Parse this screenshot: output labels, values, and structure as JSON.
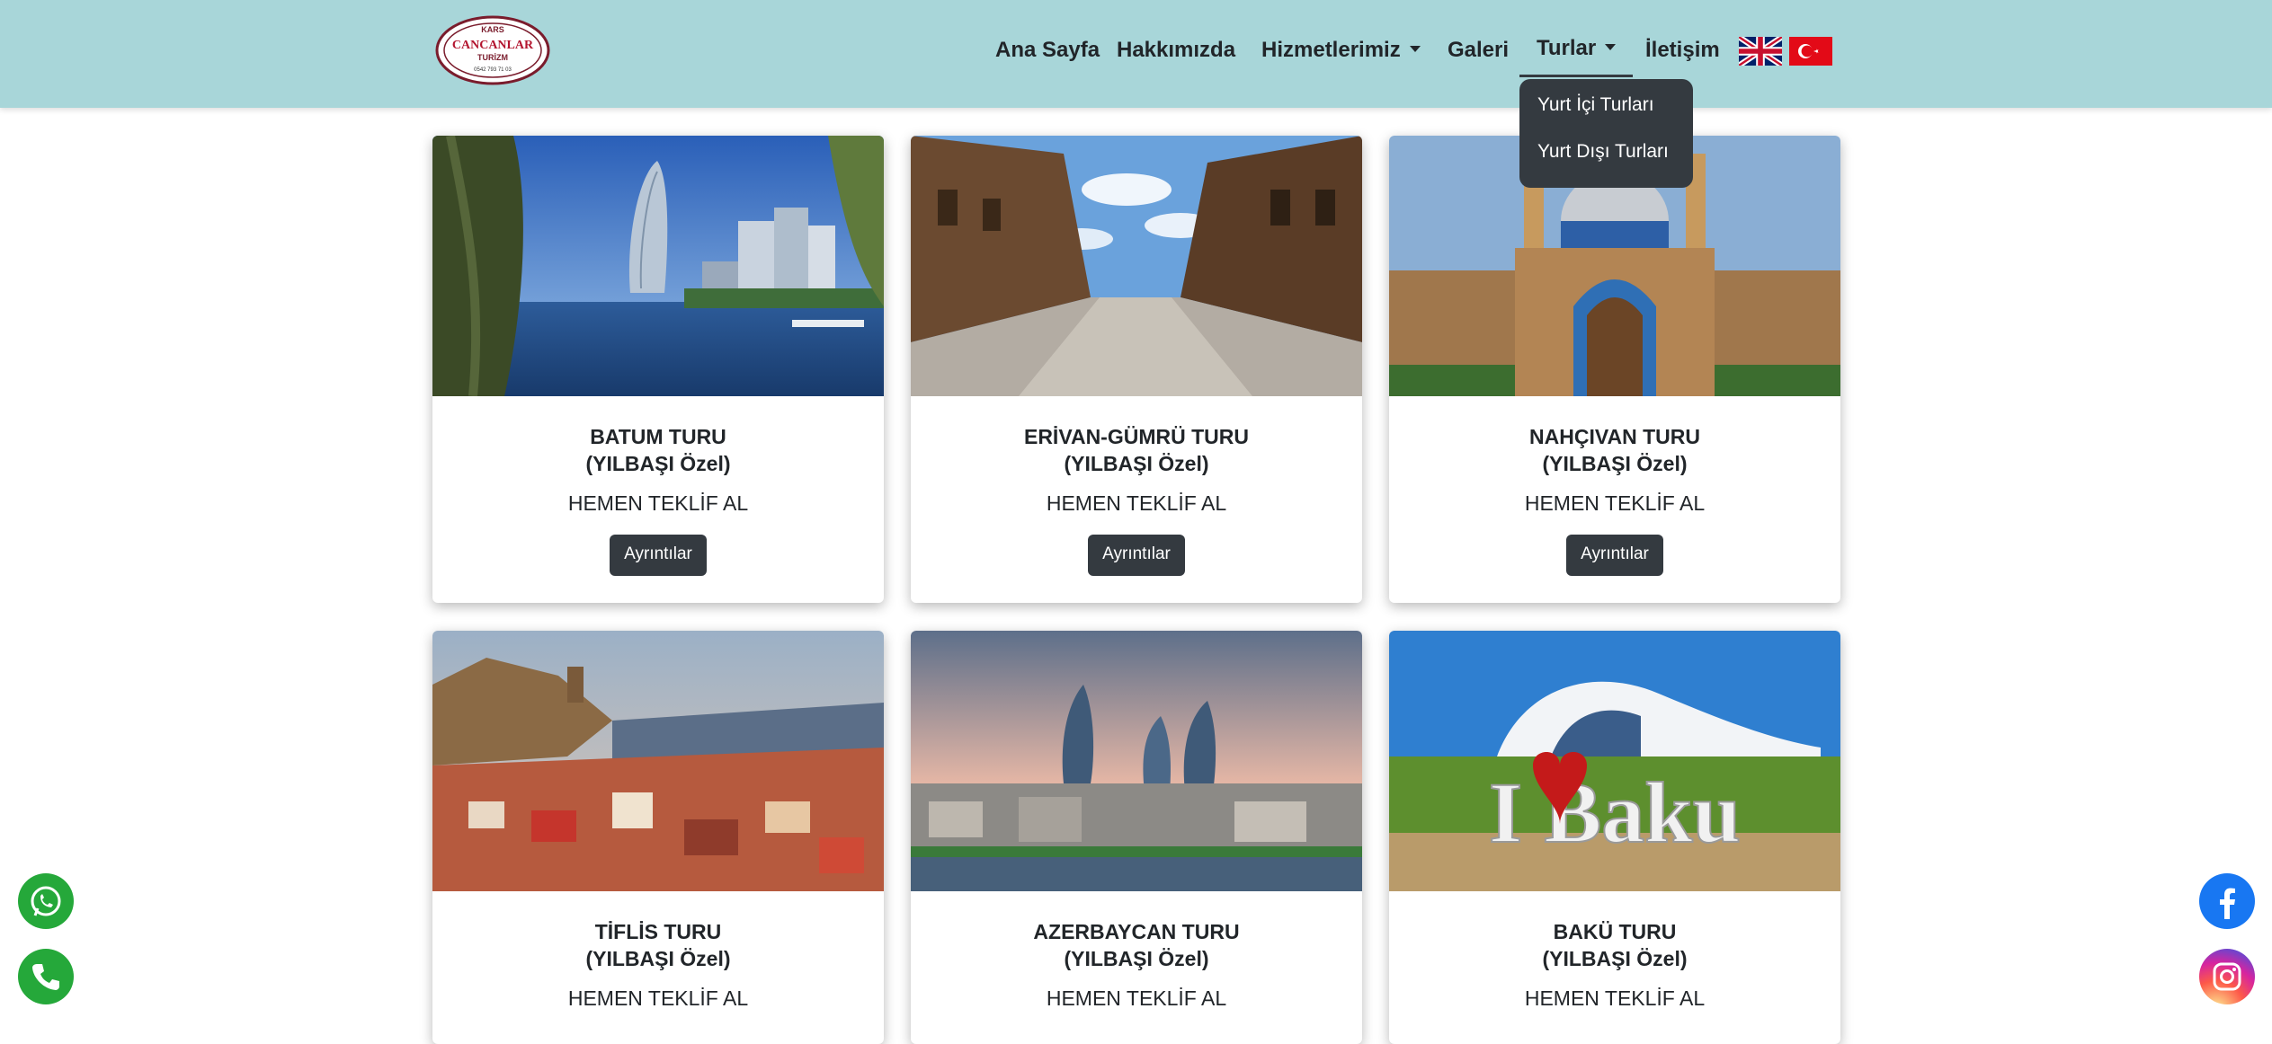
{
  "brand": {
    "logo_text_top": "KARS",
    "logo_text_main": "CANCANLAR",
    "logo_text_sub": "TURİZM",
    "logo_phone": "0542 793 71 03"
  },
  "nav": {
    "home": "Ana Sayfa",
    "about": "Hakkımızda",
    "services": "Hizmetlerimiz",
    "gallery": "Galeri",
    "tours": "Turlar",
    "contact": "İletişim"
  },
  "tours_dropdown": {
    "domestic": "Yurt İçi Turları",
    "international": "Yurt Dışı Turları"
  },
  "cards": [
    {
      "title_line1": "BATUM TURU",
      "title_line2": "(YILBAŞI Özel)",
      "offer": "HEMEN TEKLİF AL",
      "button": "Ayrıntılar",
      "image": "batumi-skyline-lake"
    },
    {
      "title_line1": "ERİVAN-GÜMRÜ TURU",
      "title_line2": "(YILBAŞI Özel)",
      "offer": "HEMEN TEKLİF AL",
      "button": "Ayrıntılar",
      "image": "gyumri-stone-street"
    },
    {
      "title_line1": "NAHÇIVAN TURU",
      "title_line2": "(YILBAŞI Özel)",
      "offer": "HEMEN TEKLİF AL",
      "button": "Ayrıntılar",
      "image": "nakhchivan-mosque"
    },
    {
      "title_line1": "TİFLİS TURU",
      "title_line2": "(YILBAŞI Özel)",
      "offer": "HEMEN TEKLİF AL",
      "button": "Ayrıntılar",
      "image": "tbilisi-old-town"
    },
    {
      "title_line1": "AZERBAYCAN TURU",
      "title_line2": "(YILBAŞI Özel)",
      "offer": "HEMEN TEKLİF AL",
      "button": "Ayrıntılar",
      "image": "baku-flame-towers"
    },
    {
      "title_line1": "BAKÜ TURU",
      "title_line2": "(YILBAŞI Özel)",
      "offer": "HEMEN TEKLİF AL",
      "button": "Ayrıntılar",
      "image": "i-love-baku-sign"
    }
  ],
  "baku_sign_text": "I Baku",
  "floating": {
    "whatsapp_icon": "whatsapp-icon",
    "phone_icon": "phone-icon",
    "facebook_icon": "facebook-icon",
    "instagram_icon": "instagram-icon"
  },
  "colors": {
    "navbar_bg": "#a8d6d9",
    "dark_button": "#343a40",
    "whatsapp_green": "#25a83a",
    "facebook_blue": "#1877f2"
  }
}
